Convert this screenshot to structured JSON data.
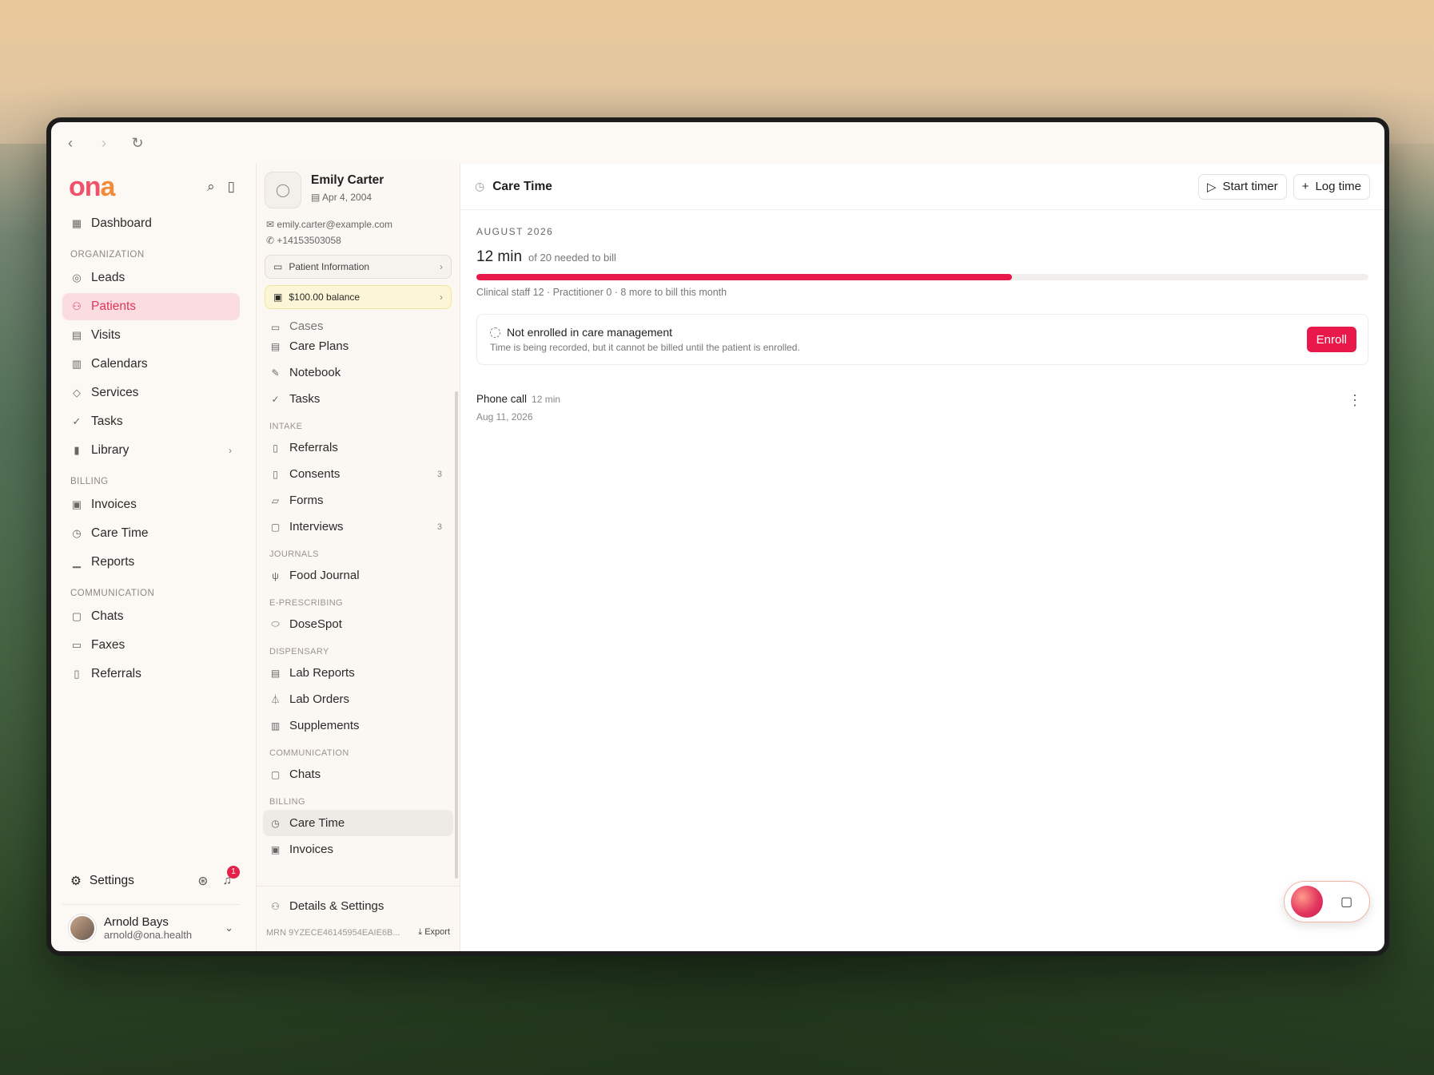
{
  "browser": {
    "back": "‹",
    "forward": "›",
    "reload": "↻"
  },
  "brand": {
    "logo_a": "on",
    "logo_b": "a",
    "primary_color": "#e8184a",
    "accent_color": "#f28a3a"
  },
  "sidebar": {
    "dashboard": "Dashboard",
    "sections": {
      "organization": "ORGANIZATION",
      "billing": "BILLING",
      "communication": "COMMUNICATION"
    },
    "organization_items": [
      {
        "label": "Leads",
        "icon": "target-icon"
      },
      {
        "label": "Patients",
        "icon": "users-icon"
      },
      {
        "label": "Visits",
        "icon": "calendar-icon"
      },
      {
        "label": "Calendars",
        "icon": "calendar-grid-icon"
      },
      {
        "label": "Services",
        "icon": "tag-icon"
      },
      {
        "label": "Tasks",
        "icon": "check-circle-icon"
      },
      {
        "label": "Library",
        "icon": "library-icon"
      }
    ],
    "billing_items": [
      {
        "label": "Invoices",
        "icon": "invoice-icon"
      },
      {
        "label": "Care Time",
        "icon": "timer-icon"
      },
      {
        "label": "Reports",
        "icon": "chart-icon"
      }
    ],
    "communication_items": [
      {
        "label": "Chats",
        "icon": "chat-icon"
      },
      {
        "label": "Faxes",
        "icon": "printer-icon"
      },
      {
        "label": "Referrals",
        "icon": "document-icon"
      }
    ],
    "settings": "Settings",
    "notifications_count": "1",
    "user": {
      "name": "Arnold Bays",
      "email": "arnold@ona.health"
    }
  },
  "patient": {
    "name": "Emily Carter",
    "dob": "Apr 4, 2004",
    "email": "emily.carter@example.com",
    "phone": "+14153503058",
    "info_button": "Patient Information",
    "balance_button": "$100.00 balance",
    "cut_item": "Cases",
    "top_items": [
      "Care Plans",
      "Notebook",
      "Tasks"
    ],
    "sections": {
      "intake": "INTAKE",
      "journals": "JOURNALS",
      "eprescribing": "E-PRESCRIBING",
      "dispensary": "DISPENSARY",
      "communication": "COMMUNICATION",
      "billing": "BILLING"
    },
    "intake_items": [
      {
        "label": "Referrals",
        "count": ""
      },
      {
        "label": "Consents",
        "count": "3"
      },
      {
        "label": "Forms",
        "count": ""
      },
      {
        "label": "Interviews",
        "count": "3"
      }
    ],
    "journals_items": [
      "Food Journal"
    ],
    "eprescribing_items": [
      "DoseSpot"
    ],
    "dispensary_items": [
      "Lab Reports",
      "Lab Orders",
      "Supplements"
    ],
    "communication_items": [
      "Chats"
    ],
    "billing_items": [
      "Care Time",
      "Invoices"
    ],
    "details": "Details & Settings",
    "mrn_label": "MRN",
    "mrn_value": "9YZECE46145954EAIE6B...",
    "export": "Export"
  },
  "main": {
    "title": "Care Time",
    "start_timer": "Start timer",
    "log_time": "Log time",
    "month": "AUGUST 2026",
    "minutes": "12 min",
    "needed": "of 20 needed to bill",
    "progress_fraction": 0.6,
    "note": "Clinical staff 12 · Practitioner 0 · 8 more to bill this month",
    "enroll": {
      "title": "Not enrolled in care management",
      "subtitle": "Time is being recorded, but it cannot be billed until the patient is enrolled.",
      "button": "Enroll"
    },
    "entries": [
      {
        "title": "Phone call",
        "duration": "12 min",
        "date": "Aug 11, 2026"
      }
    ]
  }
}
